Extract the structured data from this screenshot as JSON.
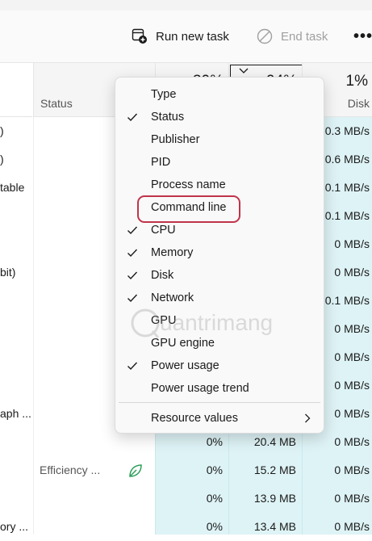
{
  "toolbar": {
    "run_new_task": "Run new task",
    "end_task": "End task",
    "more": "•••"
  },
  "columns": {
    "status": "Status",
    "cpu_pct": "30%",
    "mem_pct": "94%",
    "disk_pct": "1%",
    "disk_label": "Disk"
  },
  "rows": [
    {
      "name": ")",
      "status": "",
      "cpu": "",
      "mem": "",
      "disk": "0.3 MB/s"
    },
    {
      "name": ")",
      "status": "",
      "cpu": "",
      "mem": "",
      "disk": "0.6 MB/s"
    },
    {
      "name": "table",
      "status": "",
      "cpu": "",
      "mem": "",
      "disk": "0.1 MB/s"
    },
    {
      "name": "",
      "status": "",
      "cpu": "",
      "mem": "",
      "disk": "0.1 MB/s"
    },
    {
      "name": "",
      "status": "",
      "cpu": "",
      "mem": "",
      "disk": "0 MB/s"
    },
    {
      "name": "bit)",
      "status": "",
      "cpu": "",
      "mem": "",
      "disk": "0 MB/s"
    },
    {
      "name": "",
      "status": "",
      "cpu": "",
      "mem": "",
      "disk": "0.1 MB/s"
    },
    {
      "name": "",
      "status": "",
      "cpu": "",
      "mem": "",
      "disk": "0 MB/s"
    },
    {
      "name": "",
      "status": "",
      "cpu": "",
      "mem": "",
      "disk": "0 MB/s"
    },
    {
      "name": "",
      "status": "",
      "cpu": "",
      "mem": "",
      "disk": "0 MB/s"
    },
    {
      "name": "aph ...",
      "status": "",
      "cpu": "",
      "mem": "",
      "disk": "0 MB/s"
    },
    {
      "name": "",
      "status": "",
      "cpu": "0%",
      "mem": "20.4 MB",
      "disk": "0 MB/s"
    },
    {
      "name": "",
      "status": "Efficiency ...",
      "cpu": "0%",
      "mem": "15.2 MB",
      "disk": "0 MB/s"
    },
    {
      "name": "",
      "status": "",
      "cpu": "0%",
      "mem": "13.9 MB",
      "disk": "0 MB/s"
    },
    {
      "name": "ory ...",
      "status": "",
      "cpu": "0%",
      "mem": "13.4 MB",
      "disk": "0 MB/s"
    }
  ],
  "menu": {
    "items": [
      {
        "label": "Type",
        "checked": false
      },
      {
        "label": "Status",
        "checked": true
      },
      {
        "label": "Publisher",
        "checked": false
      },
      {
        "label": "PID",
        "checked": false
      },
      {
        "label": "Process name",
        "checked": false
      },
      {
        "label": "Command line",
        "checked": false
      },
      {
        "label": "CPU",
        "checked": true
      },
      {
        "label": "Memory",
        "checked": true
      },
      {
        "label": "Disk",
        "checked": true
      },
      {
        "label": "Network",
        "checked": true
      },
      {
        "label": "GPU",
        "checked": false
      },
      {
        "label": "GPU engine",
        "checked": false
      },
      {
        "label": "Power usage",
        "checked": true
      },
      {
        "label": "Power usage trend",
        "checked": false
      }
    ],
    "resource_values": "Resource values"
  },
  "colors": {
    "heat_column": "#def3f6",
    "highlight_outline": "#c0344a",
    "efficiency_leaf": "#2e9e5b"
  }
}
